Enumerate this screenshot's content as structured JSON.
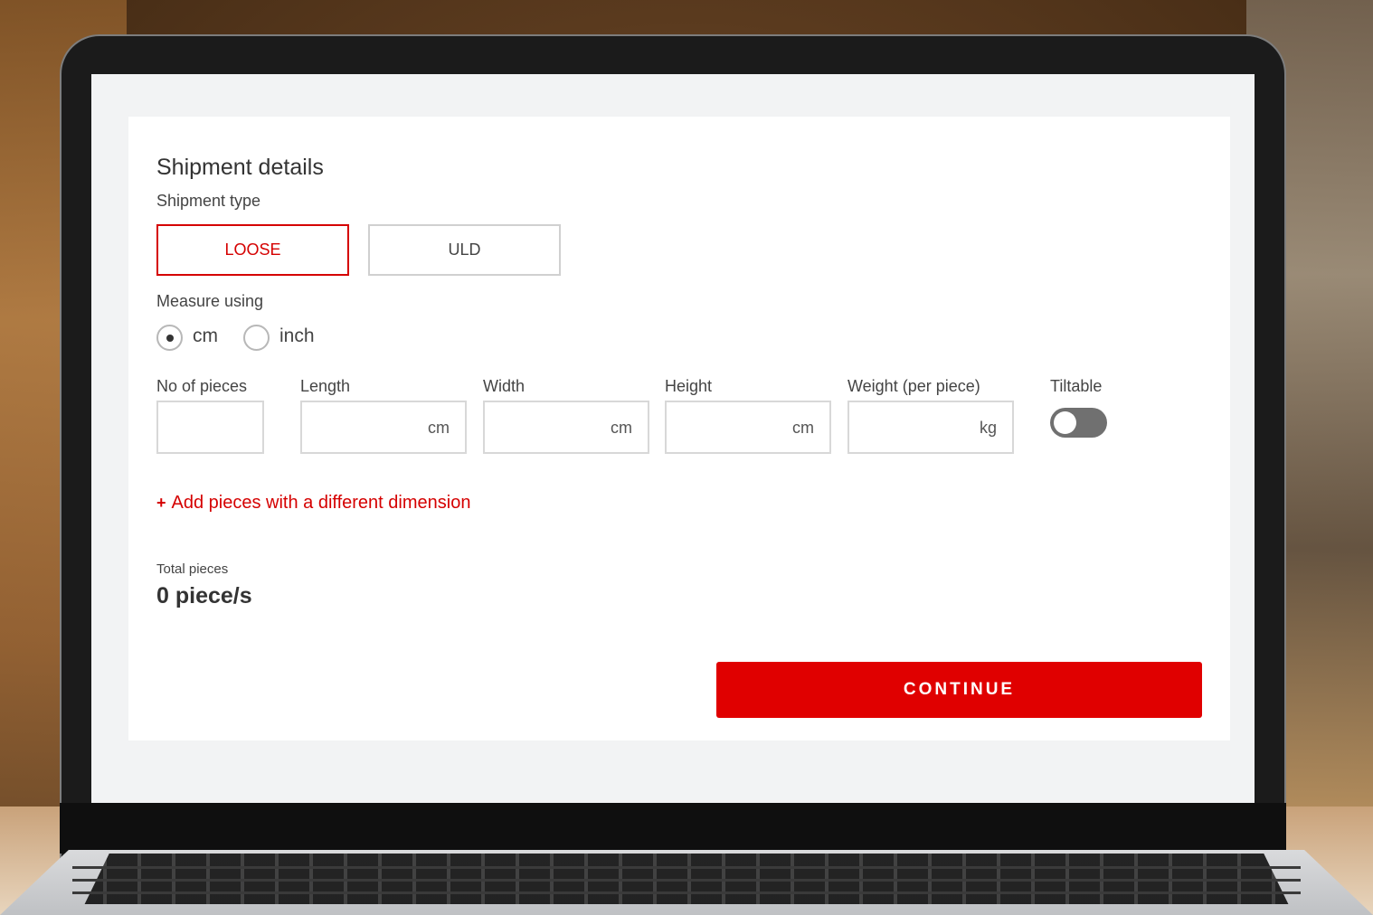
{
  "form": {
    "title": "Shipment details",
    "shipment_type_label": "Shipment type",
    "shipment_types": [
      {
        "label": "LOOSE",
        "selected": true
      },
      {
        "label": "ULD",
        "selected": false
      }
    ],
    "measure_label": "Measure using",
    "measure_options": [
      {
        "label": "cm",
        "selected": true
      },
      {
        "label": "inch",
        "selected": false
      }
    ],
    "fields": {
      "pieces": {
        "label": "No of pieces",
        "value": "",
        "unit": ""
      },
      "length": {
        "label": "Length",
        "value": "",
        "unit": "cm"
      },
      "width": {
        "label": "Width",
        "value": "",
        "unit": "cm"
      },
      "height": {
        "label": "Height",
        "value": "",
        "unit": "cm"
      },
      "weight": {
        "label": "Weight (per piece)",
        "value": "",
        "unit": "kg"
      }
    },
    "tiltable": {
      "label": "Tiltable",
      "on": false
    },
    "add_link": {
      "plus": "+",
      "label": "Add pieces with a different dimension"
    },
    "total": {
      "label": "Total pieces",
      "value": "0 piece/s"
    },
    "continue_label": "CONTINUE"
  },
  "colors": {
    "accent": "#e00000",
    "selected_border": "#d50000",
    "toggle_off": "#707070"
  }
}
